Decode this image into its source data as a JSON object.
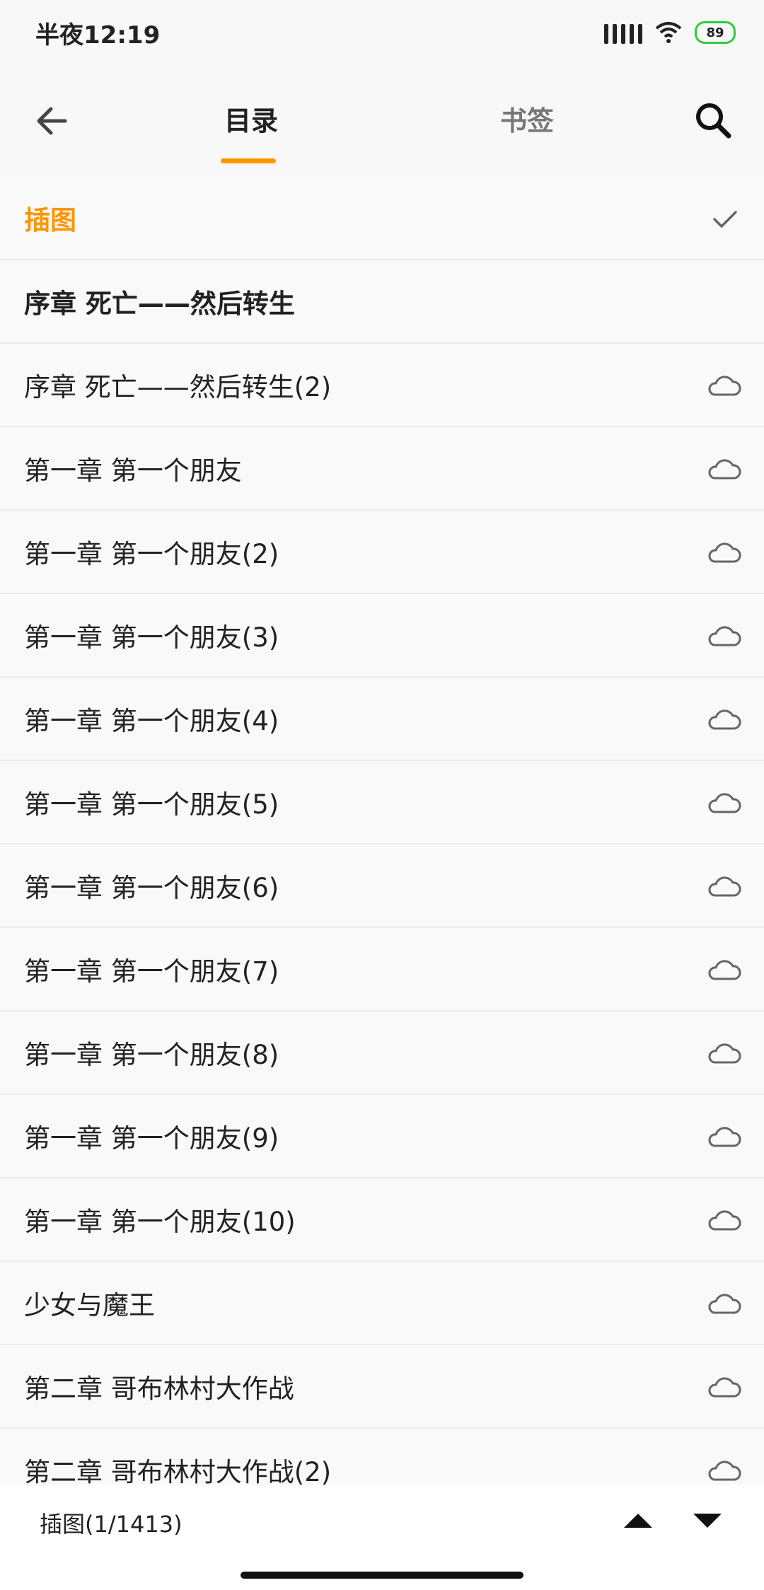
{
  "status": {
    "time": "半夜12:19",
    "battery": "89",
    "battery_color": "#2ecc40"
  },
  "header": {
    "tabs": [
      {
        "label": "目录",
        "active": true
      },
      {
        "label": "书签",
        "active": false
      }
    ],
    "accent_color": "#ff9500",
    "icons": {
      "back": "back-arrow-icon",
      "search": "search-icon"
    }
  },
  "list": {
    "items": [
      {
        "label": "插图",
        "status_icon": "check-icon"
      },
      {
        "label": "序章 死亡——然后转生",
        "status_icon": ""
      },
      {
        "label": "序章 死亡——然后转生(2)",
        "status_icon": "cloud-icon"
      },
      {
        "label": "第一章 第一个朋友",
        "status_icon": "cloud-icon"
      },
      {
        "label": "第一章 第一个朋友(2)",
        "status_icon": "cloud-icon"
      },
      {
        "label": "第一章 第一个朋友(3)",
        "status_icon": "cloud-icon"
      },
      {
        "label": "第一章 第一个朋友(4)",
        "status_icon": "cloud-icon"
      },
      {
        "label": "第一章 第一个朋友(5)",
        "status_icon": "cloud-icon"
      },
      {
        "label": "第一章 第一个朋友(6)",
        "status_icon": "cloud-icon"
      },
      {
        "label": "第一章 第一个朋友(7)",
        "status_icon": "cloud-icon"
      },
      {
        "label": "第一章 第一个朋友(8)",
        "status_icon": "cloud-icon"
      },
      {
        "label": "第一章 第一个朋友(9)",
        "status_icon": "cloud-icon"
      },
      {
        "label": "第一章 第一个朋友(10)",
        "status_icon": "cloud-icon"
      },
      {
        "label": "少女与魔王",
        "status_icon": "cloud-icon"
      },
      {
        "label": "第二章 哥布林村大作战",
        "status_icon": "cloud-icon"
      },
      {
        "label": "第二章 哥布林村大作战(2)",
        "status_icon": "cloud-icon"
      }
    ]
  },
  "footer": {
    "position_label": "插图(1/1413)",
    "icons": {
      "up": "scroll-up-icon",
      "down": "scroll-down-icon"
    }
  }
}
